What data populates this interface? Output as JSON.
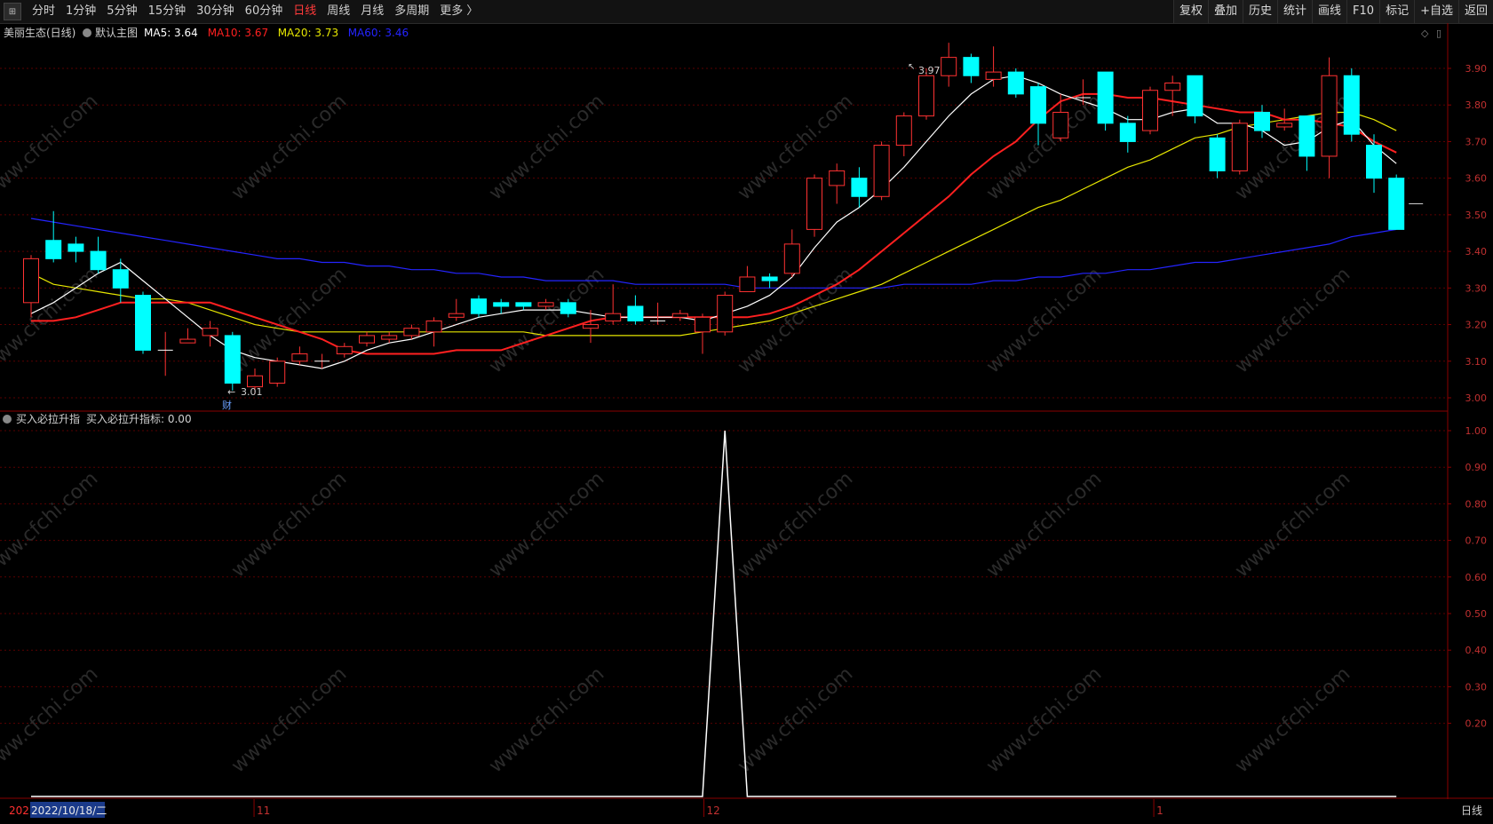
{
  "toolbar": {
    "periods": [
      "分时",
      "1分钟",
      "5分钟",
      "15分钟",
      "30分钟",
      "60分钟",
      "日线",
      "周线",
      "月线",
      "多周期",
      "更多 〉"
    ],
    "active_period": "日线",
    "right_buttons": [
      "复权",
      "叠加",
      "历史",
      "统计",
      "画线",
      "F10",
      "标记",
      "+自选",
      "返回"
    ]
  },
  "main_chart": {
    "stock_name": "美丽生态(日线)",
    "template": "默认主图",
    "ma": [
      {
        "label": "MA5: 3.64",
        "color": "#ffffff"
      },
      {
        "label": "MA10: 3.67",
        "color": "#ff2020"
      },
      {
        "label": "MA20: 3.73",
        "color": "#e6e600"
      },
      {
        "label": "MA60: 3.46",
        "color": "#2424ff"
      }
    ],
    "high_mark": "3.97",
    "low_mark": "3.01",
    "event_mark": "财",
    "y_ticks": [
      "3.90",
      "3.80",
      "3.70",
      "3.60",
      "3.50",
      "3.40",
      "3.30",
      "3.20",
      "3.10",
      "3.00"
    ]
  },
  "indicator": {
    "name": "买入必拉升指",
    "value_label": "买入必拉升指标: 0.00",
    "y_ticks": [
      "1.00",
      "0.90",
      "0.80",
      "0.70",
      "0.60",
      "0.50",
      "0.40",
      "0.30",
      "0.20"
    ]
  },
  "axis": {
    "first_label": "202",
    "cursor_date": "2022/10/18/二",
    "month_labels": [
      "11",
      "12",
      "1"
    ],
    "period_label": "日线"
  },
  "watermark": "www.cfchi.com",
  "colors": {
    "up": "#ff3232",
    "down": "#00ffff",
    "ma5": "#ffffff",
    "ma10": "#ff2020",
    "ma20": "#e6e600",
    "ma60": "#2424ff",
    "grid": "#5a0000"
  },
  "chart_data": {
    "type": "candlestick",
    "title": "美丽生态(日线)",
    "candles": [
      [
        3.26,
        3.38,
        3.39,
        3.22
      ],
      [
        3.43,
        3.38,
        3.51,
        3.37
      ],
      [
        3.42,
        3.4,
        3.44,
        3.37
      ],
      [
        3.4,
        3.35,
        3.44,
        3.34
      ],
      [
        3.35,
        3.3,
        3.38,
        3.26
      ],
      [
        3.28,
        3.13,
        3.29,
        3.12
      ],
      [
        3.13,
        3.13,
        3.18,
        3.06
      ],
      [
        3.15,
        3.16,
        3.19,
        3.15
      ],
      [
        3.17,
        3.19,
        3.21,
        3.14
      ],
      [
        3.17,
        3.04,
        3.18,
        3.02
      ],
      [
        3.03,
        3.06,
        3.08,
        3.01
      ],
      [
        3.04,
        3.1,
        3.11,
        3.03
      ],
      [
        3.1,
        3.12,
        3.14,
        3.09
      ],
      [
        3.1,
        3.1,
        3.12,
        3.08
      ],
      [
        3.12,
        3.14,
        3.15,
        3.11
      ],
      [
        3.15,
        3.17,
        3.18,
        3.14
      ],
      [
        3.16,
        3.17,
        3.18,
        3.15
      ],
      [
        3.17,
        3.19,
        3.2,
        3.16
      ],
      [
        3.18,
        3.21,
        3.22,
        3.14
      ],
      [
        3.22,
        3.23,
        3.27,
        3.21
      ],
      [
        3.27,
        3.23,
        3.28,
        3.22
      ],
      [
        3.26,
        3.25,
        3.27,
        3.23
      ],
      [
        3.26,
        3.25,
        3.26,
        3.24
      ],
      [
        3.25,
        3.26,
        3.27,
        3.24
      ],
      [
        3.26,
        3.23,
        3.27,
        3.22
      ],
      [
        3.19,
        3.2,
        3.24,
        3.15
      ],
      [
        3.21,
        3.23,
        3.31,
        3.2
      ],
      [
        3.25,
        3.21,
        3.28,
        3.2
      ],
      [
        3.21,
        3.21,
        3.26,
        3.2
      ],
      [
        3.22,
        3.23,
        3.24,
        3.21
      ],
      [
        3.18,
        3.22,
        3.23,
        3.12
      ],
      [
        3.18,
        3.28,
        3.29,
        3.17
      ],
      [
        3.29,
        3.33,
        3.36,
        3.29
      ],
      [
        3.33,
        3.32,
        3.34,
        3.3
      ],
      [
        3.34,
        3.42,
        3.46,
        3.33
      ],
      [
        3.46,
        3.6,
        3.61,
        3.44
      ],
      [
        3.58,
        3.62,
        3.64,
        3.53
      ],
      [
        3.6,
        3.55,
        3.63,
        3.52
      ],
      [
        3.55,
        3.69,
        3.7,
        3.54
      ],
      [
        3.69,
        3.77,
        3.78,
        3.66
      ],
      [
        3.77,
        3.88,
        3.9,
        3.76
      ],
      [
        3.88,
        3.93,
        3.97,
        3.85
      ],
      [
        3.93,
        3.88,
        3.94,
        3.86
      ],
      [
        3.87,
        3.89,
        3.96,
        3.85
      ],
      [
        3.89,
        3.83,
        3.9,
        3.82
      ],
      [
        3.85,
        3.75,
        3.86,
        3.69
      ],
      [
        3.71,
        3.78,
        3.83,
        3.7
      ],
      [
        3.82,
        3.82,
        3.87,
        3.8
      ],
      [
        3.89,
        3.75,
        3.89,
        3.73
      ],
      [
        3.75,
        3.7,
        3.77,
        3.67
      ],
      [
        3.73,
        3.84,
        3.85,
        3.72
      ],
      [
        3.84,
        3.86,
        3.88,
        3.77
      ],
      [
        3.88,
        3.77,
        3.88,
        3.75
      ],
      [
        3.71,
        3.62,
        3.72,
        3.6
      ],
      [
        3.62,
        3.75,
        3.76,
        3.61
      ],
      [
        3.78,
        3.73,
        3.8,
        3.71
      ],
      [
        3.74,
        3.75,
        3.79,
        3.73
      ],
      [
        3.77,
        3.66,
        3.77,
        3.62
      ],
      [
        3.66,
        3.88,
        3.93,
        3.6
      ],
      [
        3.88,
        3.72,
        3.9,
        3.7
      ],
      [
        3.69,
        3.6,
        3.72,
        3.56
      ],
      [
        3.6,
        3.46,
        3.61,
        3.46
      ]
    ],
    "ma5": [
      3.23,
      3.26,
      3.3,
      3.34,
      3.37,
      3.32,
      3.27,
      3.22,
      3.17,
      3.13,
      3.11,
      3.1,
      3.09,
      3.08,
      3.1,
      3.13,
      3.15,
      3.16,
      3.18,
      3.2,
      3.22,
      3.23,
      3.24,
      3.24,
      3.24,
      3.23,
      3.22,
      3.22,
      3.22,
      3.22,
      3.21,
      3.23,
      3.25,
      3.28,
      3.33,
      3.41,
      3.48,
      3.52,
      3.57,
      3.63,
      3.7,
      3.77,
      3.83,
      3.87,
      3.88,
      3.86,
      3.83,
      3.81,
      3.79,
      3.76,
      3.76,
      3.78,
      3.79,
      3.75,
      3.75,
      3.73,
      3.69,
      3.7,
      3.74,
      3.76,
      3.69,
      3.64
    ],
    "ma10": [
      3.21,
      3.21,
      3.22,
      3.24,
      3.26,
      3.26,
      3.26,
      3.26,
      3.26,
      3.24,
      3.22,
      3.2,
      3.18,
      3.16,
      3.13,
      3.12,
      3.12,
      3.12,
      3.12,
      3.13,
      3.13,
      3.13,
      3.15,
      3.17,
      3.19,
      3.21,
      3.22,
      3.22,
      3.22,
      3.22,
      3.22,
      3.22,
      3.22,
      3.23,
      3.25,
      3.28,
      3.31,
      3.35,
      3.4,
      3.45,
      3.5,
      3.55,
      3.61,
      3.66,
      3.7,
      3.76,
      3.81,
      3.83,
      3.83,
      3.82,
      3.82,
      3.81,
      3.8,
      3.79,
      3.78,
      3.78,
      3.76,
      3.76,
      3.75,
      3.74,
      3.7,
      3.67
    ],
    "ma20": [
      3.34,
      3.31,
      3.3,
      3.29,
      3.28,
      3.27,
      3.27,
      3.26,
      3.24,
      3.22,
      3.2,
      3.19,
      3.18,
      3.18,
      3.18,
      3.18,
      3.18,
      3.18,
      3.18,
      3.18,
      3.18,
      3.18,
      3.18,
      3.17,
      3.17,
      3.17,
      3.17,
      3.17,
      3.17,
      3.17,
      3.18,
      3.19,
      3.2,
      3.21,
      3.23,
      3.25,
      3.27,
      3.29,
      3.31,
      3.34,
      3.37,
      3.4,
      3.43,
      3.46,
      3.49,
      3.52,
      3.54,
      3.57,
      3.6,
      3.63,
      3.65,
      3.68,
      3.71,
      3.72,
      3.74,
      3.75,
      3.76,
      3.77,
      3.78,
      3.78,
      3.76,
      3.73
    ],
    "ma60": [
      3.49,
      3.48,
      3.47,
      3.46,
      3.45,
      3.44,
      3.43,
      3.42,
      3.41,
      3.4,
      3.39,
      3.38,
      3.38,
      3.37,
      3.37,
      3.36,
      3.36,
      3.35,
      3.35,
      3.34,
      3.34,
      3.33,
      3.33,
      3.32,
      3.32,
      3.32,
      3.32,
      3.31,
      3.31,
      3.31,
      3.31,
      3.31,
      3.3,
      3.3,
      3.3,
      3.3,
      3.3,
      3.3,
      3.3,
      3.31,
      3.31,
      3.31,
      3.31,
      3.32,
      3.32,
      3.33,
      3.33,
      3.34,
      3.34,
      3.35,
      3.35,
      3.36,
      3.37,
      3.37,
      3.38,
      3.39,
      3.4,
      3.41,
      3.42,
      3.44,
      3.45,
      3.46
    ],
    "ylim": [
      2.97,
      4.0
    ],
    "indicator_values": [
      0,
      0,
      0,
      0,
      0,
      0,
      0,
      0,
      0,
      0,
      0,
      0,
      0,
      0,
      0,
      0,
      0,
      0,
      0,
      0,
      0,
      0,
      0,
      0,
      0,
      0,
      0,
      0,
      0,
      0,
      0,
      1,
      0,
      0,
      0,
      0,
      0,
      0,
      0,
      0,
      0,
      0,
      0,
      0,
      0,
      0,
      0,
      0,
      0,
      0,
      0,
      0,
      0,
      0,
      0,
      0,
      0,
      0,
      0,
      0,
      0,
      0
    ],
    "indicator_ylim": [
      0,
      1.0
    ]
  }
}
